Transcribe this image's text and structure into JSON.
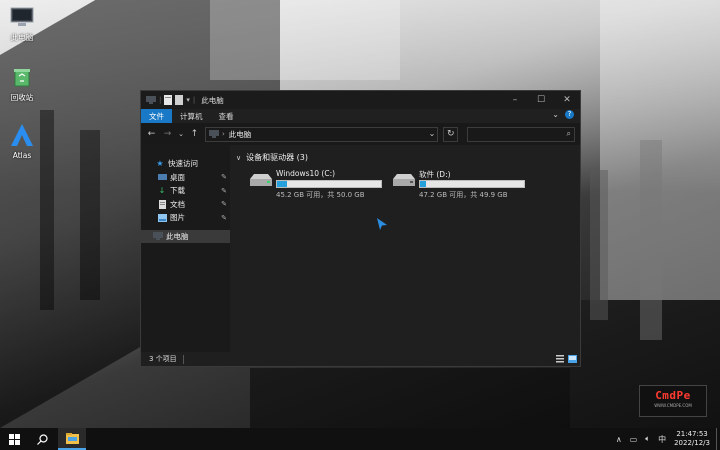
{
  "desktop": {
    "icons": [
      {
        "label": "此电脑",
        "icon": "monitor-icon"
      },
      {
        "label": "回收站",
        "icon": "recycle-bin-icon"
      },
      {
        "label": "Atlas",
        "icon": "atlas-logo-icon"
      }
    ]
  },
  "window": {
    "title": "此电脑",
    "ribbon_tabs": [
      "文件",
      "计算机",
      "查看"
    ],
    "address": {
      "crumb": "此电脑",
      "placeholder": ""
    },
    "nav": {
      "quick_access": "快速访问",
      "quick_items": [
        "桌面",
        "下载",
        "文档",
        "图片"
      ],
      "this_pc": "此电脑"
    },
    "content": {
      "group_title": "设备和驱动器 (3)",
      "drives": [
        {
          "name": "Windows10 (C:)",
          "free_text": "45.2 GB 可用，共 50.0 GB",
          "used_fraction": 0.096
        },
        {
          "name": "软件 (D:)",
          "free_text": "47.2 GB 可用，共 49.9 GB",
          "used_fraction": 0.054
        }
      ]
    },
    "status": "3 个项目"
  },
  "watermark": {
    "brand": "CmdPe",
    "url": "WWW.CMDPE.COM"
  },
  "taskbar": {
    "ime": "中",
    "time": "21:47:53",
    "date": "2022/12/3"
  },
  "colors": {
    "accent": "#1979c6",
    "progress": "#26a0da",
    "brand_red": "#ff3b2f"
  }
}
